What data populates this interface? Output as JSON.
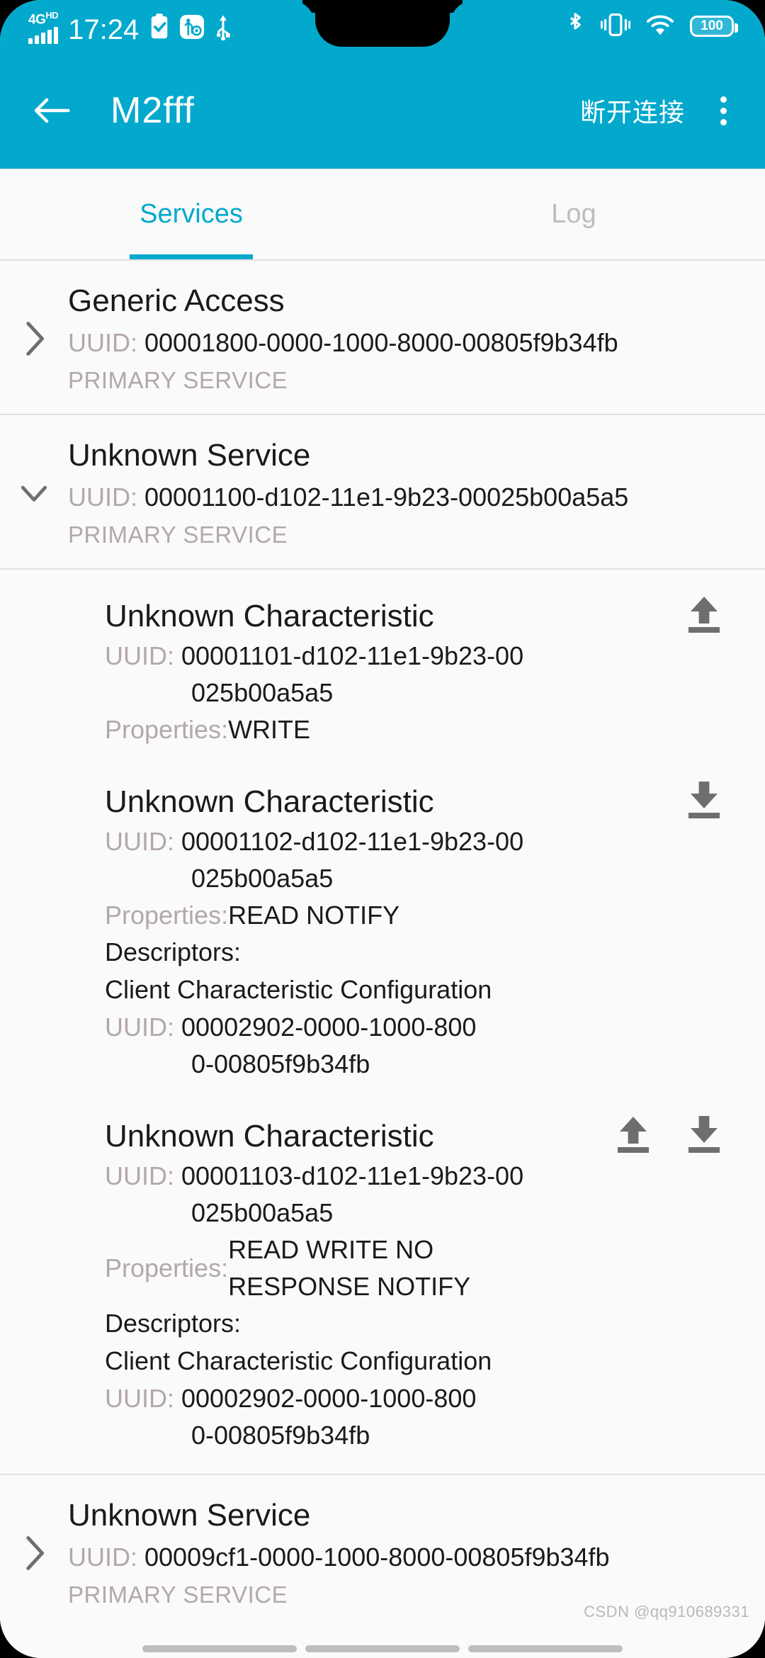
{
  "status_bar": {
    "network_label": "4G",
    "network_sup": "HD",
    "time": "17:24",
    "icons_left": [
      "signal-bars-icon",
      "clipboard-check-icon",
      "usb-debug-icon",
      "usb-icon"
    ],
    "icons_right": [
      "bluetooth-icon",
      "vibrate-icon",
      "wifi-icon"
    ],
    "battery_level": "100"
  },
  "app_bar": {
    "back_icon": "arrow-left-icon",
    "title": "M2fff",
    "action_label": "断开连接",
    "overflow_icon": "more-vertical-icon",
    "accent_color": "#03A9CD"
  },
  "tabs": [
    {
      "label": "Services",
      "active": true
    },
    {
      "label": "Log",
      "active": false
    }
  ],
  "labels": {
    "uuid_prefix": "UUID:",
    "primary_service": "PRIMARY SERVICE",
    "properties_prefix": "Properties:",
    "descriptors_header": "Descriptors:"
  },
  "services": [
    {
      "name": "Generic Access",
      "uuid": "00001800-0000-1000-8000-00805f9b34fb",
      "type": "PRIMARY SERVICE",
      "expanded": false,
      "chevron": "chevron-right-icon"
    },
    {
      "name": "Unknown Service",
      "uuid": "00001100-d102-11e1-9b23-00025b00a5a5",
      "type": "PRIMARY SERVICE",
      "expanded": true,
      "chevron": "chevron-down-icon"
    },
    {
      "name": "Unknown Service",
      "uuid": "00009cf1-0000-1000-8000-00805f9b34fb",
      "type": "PRIMARY SERVICE",
      "expanded": false,
      "chevron": "chevron-right-icon"
    }
  ],
  "characteristics": [
    {
      "name": "Unknown Characteristic",
      "uuid_line1": "00001101-d102-11e1-9b23-00",
      "uuid_line2": "025b00a5a5",
      "properties": "WRITE",
      "properties_line2": "",
      "actions": [
        "upload-icon"
      ],
      "descriptors": []
    },
    {
      "name": "Unknown Characteristic",
      "uuid_line1": "00001102-d102-11e1-9b23-00",
      "uuid_line2": "025b00a5a5",
      "properties": "READ NOTIFY",
      "properties_line2": "",
      "actions": [
        "download-icon"
      ],
      "descriptors": [
        {
          "name": "Client Characteristic Configuration",
          "uuid_line1": "00002902-0000-1000-800",
          "uuid_line2": "0-00805f9b34fb"
        }
      ]
    },
    {
      "name": "Unknown Characteristic",
      "uuid_line1": "00001103-d102-11e1-9b23-00",
      "uuid_line2": "025b00a5a5",
      "properties": "READ WRITE NO",
      "properties_line2": "RESPONSE NOTIFY",
      "actions": [
        "upload-icon",
        "download-icon"
      ],
      "descriptors": [
        {
          "name": "Client Characteristic Configuration",
          "uuid_line1": "00002902-0000-1000-800",
          "uuid_line2": "0-00805f9b34fb"
        }
      ]
    }
  ],
  "watermark": "CSDN @qq910689331"
}
